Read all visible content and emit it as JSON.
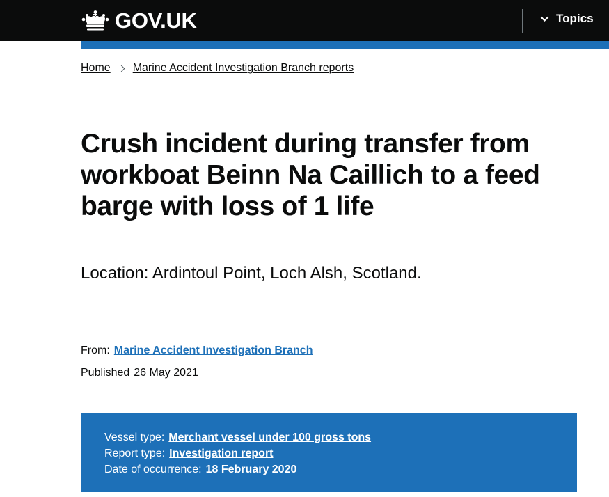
{
  "header": {
    "logo_text": "GOV.UK",
    "topics_label": "Topics"
  },
  "breadcrumb": {
    "items": [
      "Home",
      "Marine Accident Investigation Branch reports"
    ]
  },
  "page": {
    "title": "Crush incident during transfer from workboat Beinn Na Caillich to a feed barge with loss of 1 life",
    "lede": "Location: Ardintoul Point, Loch Alsh, Scotland."
  },
  "metadata": {
    "from_label": "From:",
    "from_value": "Marine Accident Investigation Branch",
    "published_label": "Published",
    "published_value": "26 May 2021"
  },
  "details": {
    "vessel_type_label": "Vessel type:",
    "vessel_type_value": "Merchant vessel under 100 gross tons",
    "report_type_label": "Report type:",
    "report_type_value": "Investigation report",
    "date_label": "Date of occurrence:",
    "date_value": "18 February 2020"
  },
  "colors": {
    "header_bg": "#0b0c0c",
    "brand_blue": "#1d70b8",
    "text": "#0b0c0c",
    "rule": "#b1b4b6"
  },
  "icons": [
    "crown-icon",
    "chevron-down-icon",
    "chevron-right-icon"
  ]
}
